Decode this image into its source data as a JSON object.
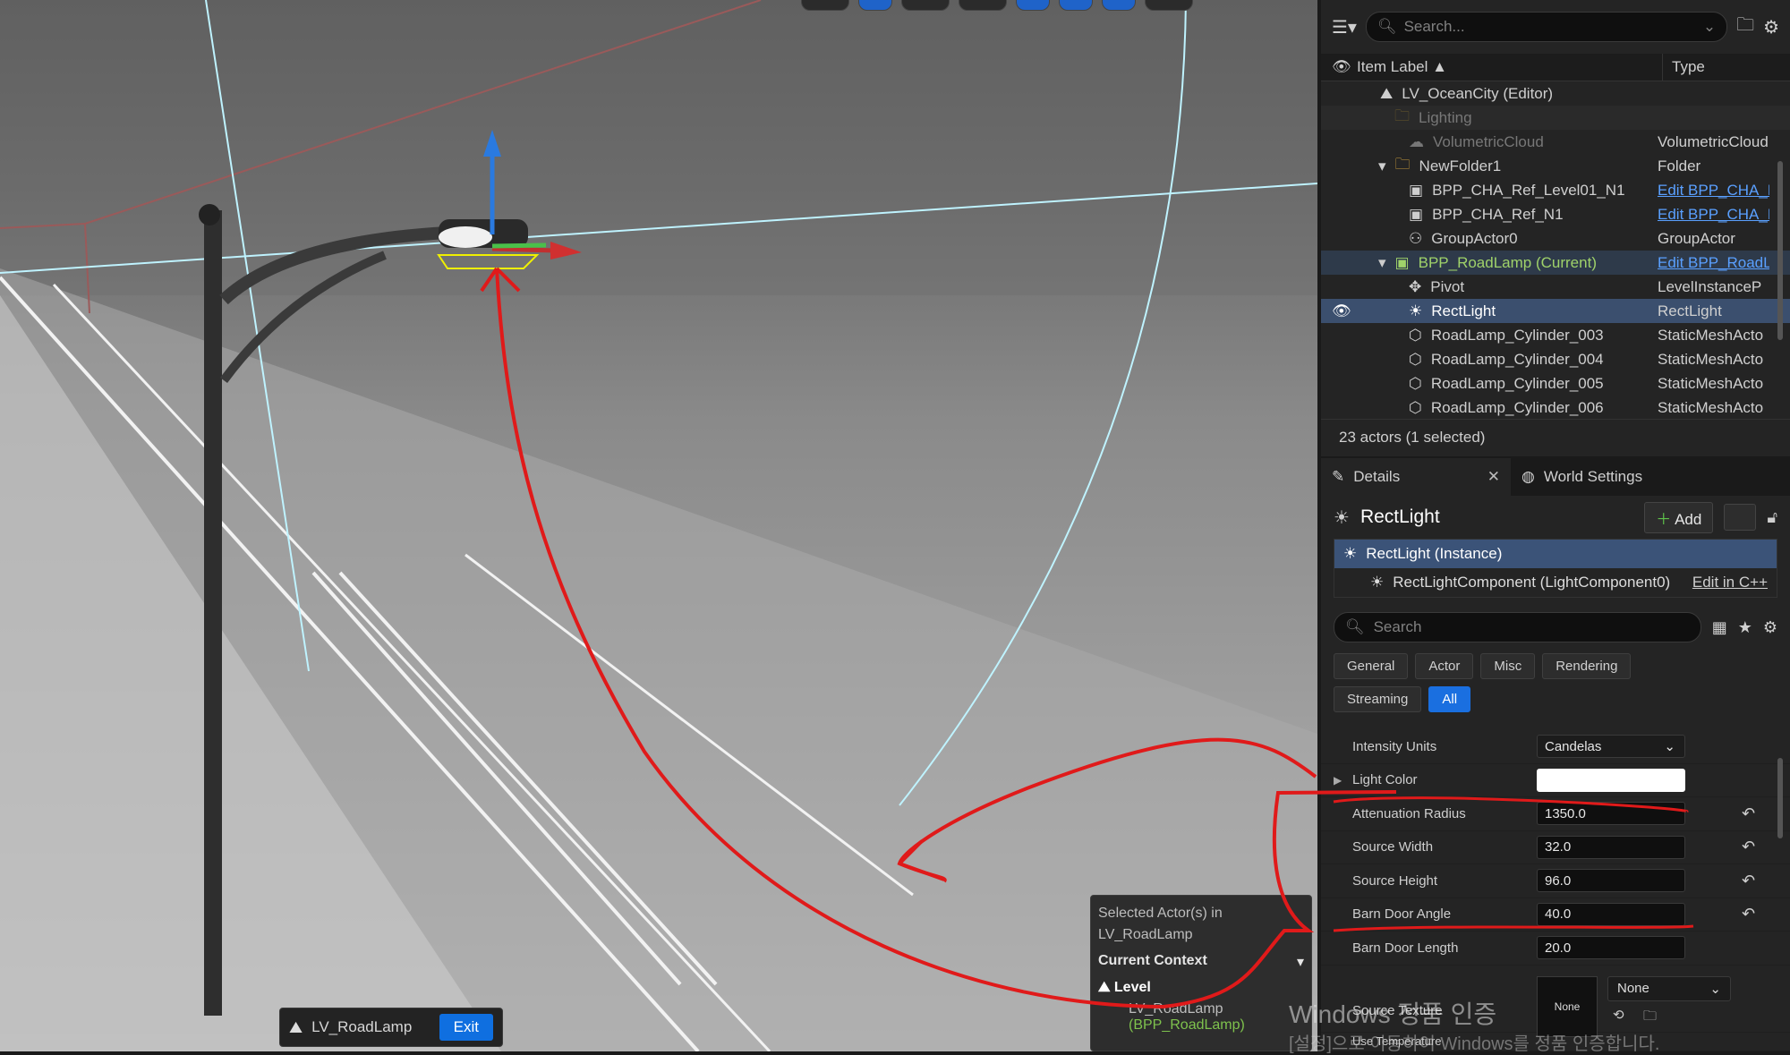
{
  "viewport": {
    "level_pill": {
      "name": "LV_RoadLamp",
      "exit_label": "Exit"
    },
    "context_panel": {
      "header_line1": "Selected Actor(s) in",
      "header_line2": "LV_RoadLamp",
      "context_label": "Current Context",
      "level_label": "Level",
      "level_name": "LV_RoadLamp",
      "level_sub": "BPP_RoadLamp)"
    }
  },
  "outliner": {
    "search_placeholder": "Search...",
    "col_label": "Item Label ▲",
    "col_type": "Type",
    "rows": [
      {
        "label": "LV_OceanCity (Editor)",
        "type": ""
      },
      {
        "label": "Lighting",
        "type": ""
      },
      {
        "label": "VolumetricCloud",
        "type": "VolumetricCloud"
      },
      {
        "label": "NewFolder1",
        "type": "Folder"
      },
      {
        "label": "BPP_CHA_Ref_Level01_N1",
        "type": "Edit BPP_CHA_R"
      },
      {
        "label": "BPP_CHA_Ref_N1",
        "type": "Edit BPP_CHA_R"
      },
      {
        "label": "GroupActor0",
        "type": "GroupActor"
      },
      {
        "label": "BPP_RoadLamp (Current)",
        "type": "Edit BPP_RoadL"
      },
      {
        "label": "Pivot",
        "type": "LevelInstanceP"
      },
      {
        "label": "RectLight",
        "type": "RectLight"
      },
      {
        "label": "RoadLamp_Cylinder_003",
        "type": "StaticMeshActo"
      },
      {
        "label": "RoadLamp_Cylinder_004",
        "type": "StaticMeshActo"
      },
      {
        "label": "RoadLamp_Cylinder_005",
        "type": "StaticMeshActo"
      },
      {
        "label": "RoadLamp_Cylinder_006",
        "type": "StaticMeshActo"
      }
    ],
    "status": "23 actors (1 selected)"
  },
  "details": {
    "tab_details": "Details",
    "tab_world": "World Settings",
    "title": "RectLight",
    "add_label": "Add",
    "tree_instance": "RectLight (Instance)",
    "tree_component": "RectLightComponent (LightComponent0)",
    "edit_cpp": "Edit in C++",
    "search_placeholder": "Search",
    "filters": [
      "General",
      "Actor",
      "Misc",
      "Rendering",
      "Streaming",
      "All"
    ],
    "props": {
      "intensity_units": {
        "name": "Intensity Units",
        "value": "Candelas"
      },
      "light_color": {
        "name": "Light Color"
      },
      "attenuation_radius": {
        "name": "Attenuation Radius",
        "value": "1350.0"
      },
      "source_width": {
        "name": "Source Width",
        "value": "32.0"
      },
      "source_height": {
        "name": "Source Height",
        "value": "96.0"
      },
      "barn_door_angle": {
        "name": "Barn Door Angle",
        "value": "40.0"
      },
      "barn_door_length": {
        "name": "Barn Door Length",
        "value": "20.0"
      },
      "source_texture": {
        "name": "Source Texture",
        "thumb": "None",
        "value": "None"
      },
      "use_temperature": {
        "name": "Use Temperature"
      }
    }
  },
  "watermark": {
    "line1": "Windows 정품 인증",
    "line2": "[설정]으로 이동하여 Windows를 정품 인증합니다."
  },
  "colors": {
    "accent": "#1a6fe0",
    "selection": "#3b4f6e",
    "annotation": "#e01a1a",
    "current_level": "#9fd26a"
  }
}
